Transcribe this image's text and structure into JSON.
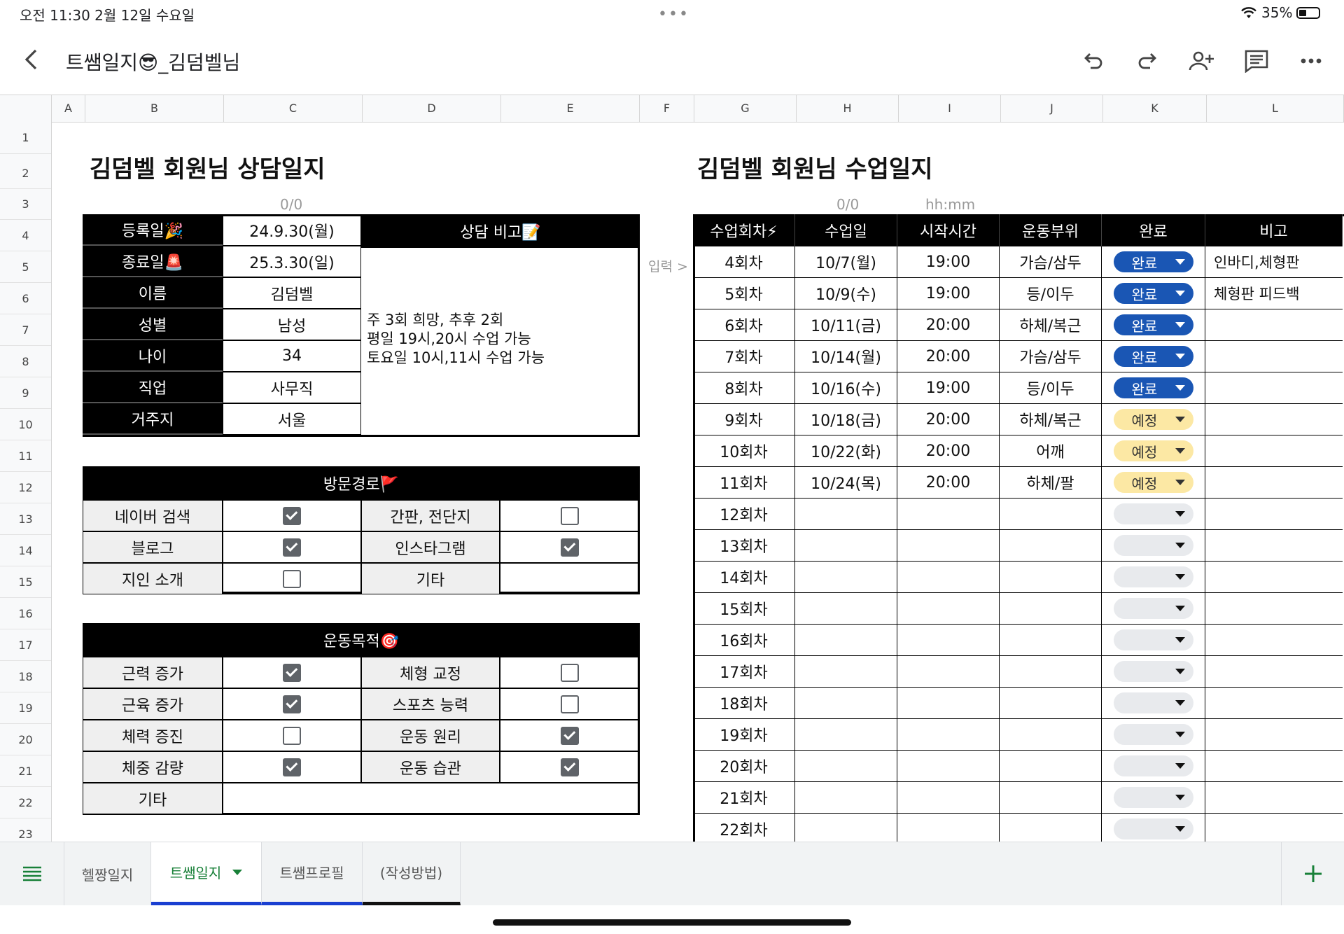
{
  "status": {
    "time_date": "오전 11:30   2월 12일 수요일",
    "battery": "35%"
  },
  "toolbar": {
    "title": "트쌤일지😎_김덤벨님"
  },
  "columns": [
    "A",
    "B",
    "C",
    "D",
    "E",
    "F",
    "G",
    "H",
    "I",
    "J",
    "K",
    "L"
  ],
  "rows": [
    "1",
    "2",
    "3",
    "4",
    "5",
    "6",
    "7",
    "8",
    "9",
    "10",
    "11",
    "12",
    "13",
    "14",
    "15",
    "16",
    "17",
    "18",
    "19",
    "20",
    "21",
    "22",
    "23"
  ],
  "left": {
    "heading": "김덤벨 회원님 상담일지",
    "counter": "0/0",
    "info": [
      {
        "label": "등록일🎉",
        "value": "24.9.30(월)"
      },
      {
        "label": "종료일🚨",
        "value": "25.3.30(일)"
      },
      {
        "label": "이름",
        "value": "김덤벨"
      },
      {
        "label": "성별",
        "value": "남성"
      },
      {
        "label": "나이",
        "value": "34"
      },
      {
        "label": "직업",
        "value": "사무직"
      },
      {
        "label": "거주지",
        "value": "서울"
      }
    ],
    "memo_header": "상담 비고📝",
    "memo_lines": [
      "주 3회 희망, 추후 2회",
      "평일 19시,20시 수업 가능",
      "토요일 10시,11시 수업 가능"
    ],
    "visit": {
      "header": "방문경로🚩",
      "items": [
        {
          "label": "네이버 검색",
          "checked": true
        },
        {
          "label": "간판, 전단지",
          "checked": false
        },
        {
          "label": "블로그",
          "checked": true
        },
        {
          "label": "인스타그램",
          "checked": true
        },
        {
          "label": "지인 소개",
          "checked": false
        },
        {
          "label": "기타"
        }
      ]
    },
    "goal": {
      "header": "운동목적🎯",
      "items": [
        {
          "label": "근력 증가",
          "checked": true
        },
        {
          "label": "체형 교정",
          "checked": false
        },
        {
          "label": "근육 증가",
          "checked": true
        },
        {
          "label": "스포츠 능력",
          "checked": false
        },
        {
          "label": "체력 증진",
          "checked": false
        },
        {
          "label": "운동 원리",
          "checked": true
        },
        {
          "label": "체중 감량",
          "checked": true
        },
        {
          "label": "운동 습관",
          "checked": true
        }
      ],
      "other": "기타"
    }
  },
  "right": {
    "heading": "김덤벨 회원님 수업일지",
    "counter": "0/0",
    "time_hint": "hh:mm",
    "input_hint": "입력 >",
    "headers": [
      "수업회차⚡",
      "수업일",
      "시작시간",
      "운동부위",
      "완료",
      "비고"
    ],
    "rows": [
      {
        "n": "4회차",
        "date": "10/7(월)",
        "time": "19:00",
        "part": "가슴/삼두",
        "status": "완료",
        "note": "인바디,체형판"
      },
      {
        "n": "5회차",
        "date": "10/9(수)",
        "time": "19:00",
        "part": "등/이두",
        "status": "완료",
        "note": "체형판 피드백"
      },
      {
        "n": "6회차",
        "date": "10/11(금)",
        "time": "20:00",
        "part": "하체/복근",
        "status": "완료",
        "note": ""
      },
      {
        "n": "7회차",
        "date": "10/14(월)",
        "time": "20:00",
        "part": "가슴/삼두",
        "status": "완료",
        "note": ""
      },
      {
        "n": "8회차",
        "date": "10/16(수)",
        "time": "19:00",
        "part": "등/이두",
        "status": "완료",
        "note": ""
      },
      {
        "n": "9회차",
        "date": "10/18(금)",
        "time": "20:00",
        "part": "하체/복근",
        "status": "예정",
        "note": ""
      },
      {
        "n": "10회차",
        "date": "10/22(화)",
        "time": "20:00",
        "part": "어깨",
        "status": "예정",
        "note": ""
      },
      {
        "n": "11회차",
        "date": "10/24(목)",
        "time": "20:00",
        "part": "하체/팔",
        "status": "예정",
        "note": ""
      },
      {
        "n": "12회차",
        "date": "",
        "time": "",
        "part": "",
        "status": "",
        "note": ""
      },
      {
        "n": "13회차",
        "date": "",
        "time": "",
        "part": "",
        "status": "",
        "note": ""
      },
      {
        "n": "14회차",
        "date": "",
        "time": "",
        "part": "",
        "status": "",
        "note": ""
      },
      {
        "n": "15회차",
        "date": "",
        "time": "",
        "part": "",
        "status": "",
        "note": ""
      },
      {
        "n": "16회차",
        "date": "",
        "time": "",
        "part": "",
        "status": "",
        "note": ""
      },
      {
        "n": "17회차",
        "date": "",
        "time": "",
        "part": "",
        "status": "",
        "note": ""
      },
      {
        "n": "18회차",
        "date": "",
        "time": "",
        "part": "",
        "status": "",
        "note": ""
      },
      {
        "n": "19회차",
        "date": "",
        "time": "",
        "part": "",
        "status": "",
        "note": ""
      },
      {
        "n": "20회차",
        "date": "",
        "time": "",
        "part": "",
        "status": "",
        "note": ""
      },
      {
        "n": "21회차",
        "date": "",
        "time": "",
        "part": "",
        "status": "",
        "note": ""
      },
      {
        "n": "22회차",
        "date": "",
        "time": "",
        "part": "",
        "status": "",
        "note": ""
      }
    ]
  },
  "tabs": [
    "헬짱일지",
    "트쌤일지",
    "트쌤프로필",
    "(작성방법)"
  ],
  "colors": {
    "done": "#1a56b4",
    "plan": "#fce8a4",
    "active_tab": "#188038"
  }
}
